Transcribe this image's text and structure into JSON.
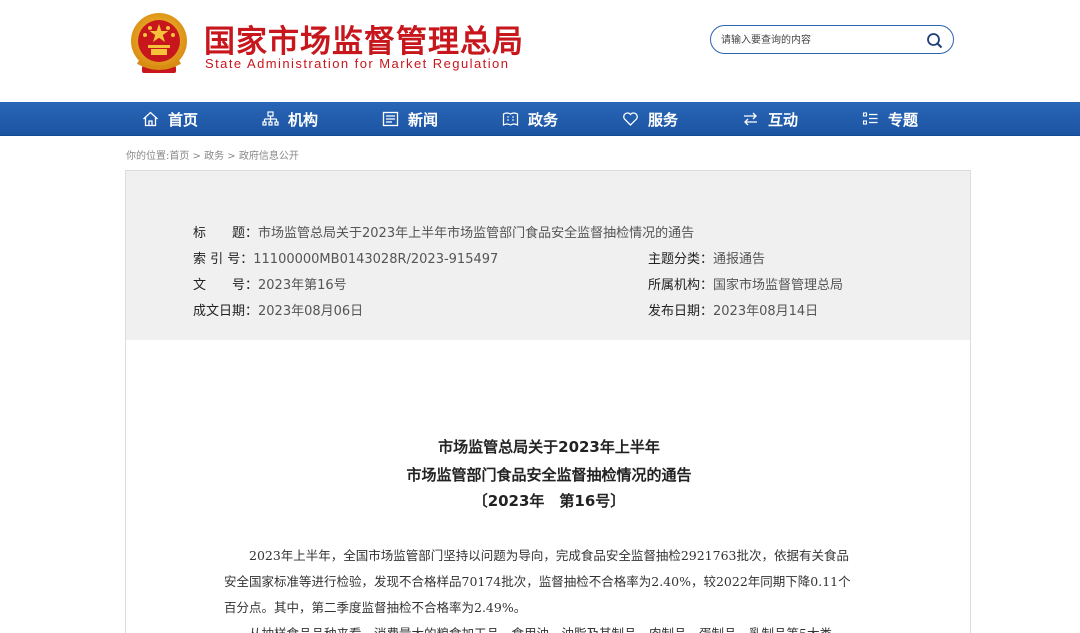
{
  "header": {
    "brand_cn": "国家市场监督管理总局",
    "brand_en": "State Administration for Market Regulation",
    "search_placeholder": "请输入要查询的内容",
    "brand_color": "#c8161d"
  },
  "nav": {
    "color": "#1f5aa8",
    "items": [
      {
        "label": "首页",
        "icon": "home-icon"
      },
      {
        "label": "机构",
        "icon": "org-chart-icon"
      },
      {
        "label": "新闻",
        "icon": "news-icon"
      },
      {
        "label": "政务",
        "icon": "affairs-icon"
      },
      {
        "label": "服务",
        "icon": "heart-icon"
      },
      {
        "label": "互动",
        "icon": "exchange-icon"
      },
      {
        "label": "专题",
        "icon": "topic-list-icon"
      }
    ]
  },
  "breadcrumb": "你的位置:首页 > 政务 > 政府信息公开",
  "meta": {
    "title_label": "标　　题：",
    "title_value": "市场监管总局关于2023年上半年市场监管部门食品安全监督抽检情况的通告",
    "index_label": "索 引 号：",
    "index_value": "11100000MB0143028R/2023-915497",
    "category_label": "主题分类：",
    "category_value": "通报通告",
    "docno_label": "文　　号：",
    "docno_value": "2023年第16号",
    "agency_label": "所属机构：",
    "agency_value": "国家市场监督管理总局",
    "created_label": "成文日期：",
    "created_value": "2023年08月06日",
    "published_label": "发布日期：",
    "published_value": "2023年08月14日"
  },
  "article": {
    "title_line1": "市场监管总局关于2023年上半年",
    "title_line2": "市场监管部门食品安全监督抽检情况的通告",
    "title_line3": "〔2023年　第16号〕",
    "paragraph1_line1": "　　2023年上半年，全国市场监管部门坚持以问题为导向，完成食品安全监督抽检2921763批次，依据有关食品",
    "paragraph1_line2": "安全国家标准等进行检验，发现不合格样品70174批次，监督抽检不合格率为2.40%，较2022年同期下降0.11个",
    "paragraph1_line3": "百分点。其中，第二季度监督抽检不合格率为2.49%。",
    "paragraph2_line1": "　　从抽样食品品种来看，消费量大的粮食加工品、食用油、油脂及其制品、肉制品、蛋制品、乳制品等5大类"
  }
}
